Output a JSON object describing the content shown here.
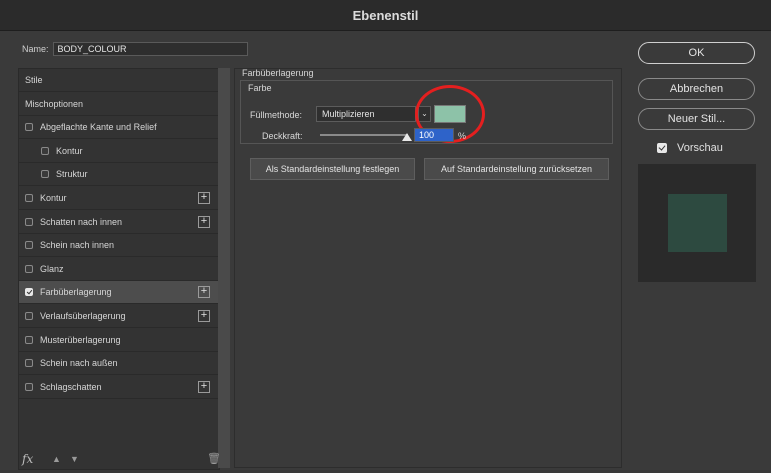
{
  "window": {
    "title": "Ebenenstil"
  },
  "name_field": {
    "label": "Name:",
    "value": "BODY_COLOUR"
  },
  "left_list": {
    "items": [
      {
        "label": "Stile",
        "type": "head",
        "checkbox": false,
        "plus": false,
        "checked": false
      },
      {
        "label": "Mischoptionen",
        "type": "head",
        "checkbox": false,
        "plus": false,
        "checked": false
      },
      {
        "label": "Abgeflachte Kante und Relief",
        "type": "row",
        "checkbox": true,
        "plus": false,
        "checked": false
      },
      {
        "label": "Kontur",
        "type": "sub",
        "checkbox": true,
        "plus": false,
        "checked": false
      },
      {
        "label": "Struktur",
        "type": "sub",
        "checkbox": true,
        "plus": false,
        "checked": false
      },
      {
        "label": "Kontur",
        "type": "row",
        "checkbox": true,
        "plus": true,
        "checked": false
      },
      {
        "label": "Schatten nach innen",
        "type": "row",
        "checkbox": true,
        "plus": true,
        "checked": false
      },
      {
        "label": "Schein nach innen",
        "type": "row",
        "checkbox": true,
        "plus": false,
        "checked": false
      },
      {
        "label": "Glanz",
        "type": "row",
        "checkbox": true,
        "plus": false,
        "checked": false
      },
      {
        "label": "Farbüberlagerung",
        "type": "row",
        "checkbox": true,
        "plus": true,
        "checked": true,
        "selected": true
      },
      {
        "label": "Verlaufsüberlagerung",
        "type": "row",
        "checkbox": true,
        "plus": true,
        "checked": false
      },
      {
        "label": "Musterüberlagerung",
        "type": "row",
        "checkbox": true,
        "plus": false,
        "checked": false
      },
      {
        "label": "Schein nach außen",
        "type": "row",
        "checkbox": true,
        "plus": false,
        "checked": false
      },
      {
        "label": "Schlagschatten",
        "type": "row",
        "checkbox": true,
        "plus": true,
        "checked": false
      }
    ],
    "bottom": {
      "fx": "fx",
      "up_icon": "arrow-up-icon",
      "down_icon": "arrow-down-icon",
      "trash_icon": "trash-icon"
    }
  },
  "color_overlay": {
    "group_title": "Farbüberlagerung",
    "sub_title": "Farbe",
    "blend_label": "Füllmethode:",
    "blend_value": "Multiplizieren",
    "swatch_color": "#8dc2a8",
    "opacity_label": "Deckkraft:",
    "opacity_value": "100",
    "opacity_unit": "%",
    "make_default": "Als Standardeinstellung festlegen",
    "reset_default": "Auf Standardeinstellung zurücksetzen"
  },
  "right": {
    "ok": "OK",
    "cancel": "Abbrechen",
    "new_style": "Neuer Stil...",
    "preview_label": "Vorschau",
    "preview_checked": true,
    "preview_color": "#2d4a40"
  },
  "highlight_color": "#e41f1f"
}
